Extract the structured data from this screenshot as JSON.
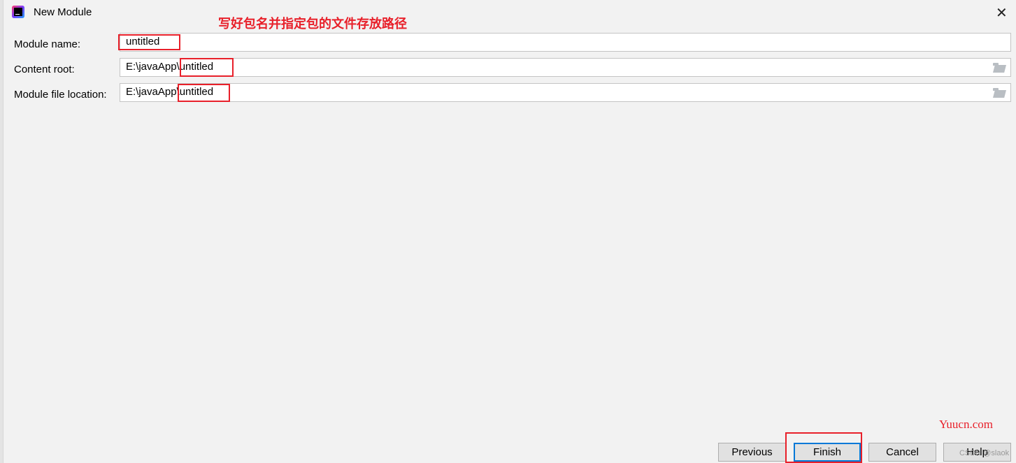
{
  "window": {
    "title": "New Module",
    "icon": "intellij-idea-icon",
    "close_icon": "close-icon"
  },
  "annotation": "写好包名并指定包的文件存放路径",
  "form": {
    "module_name": {
      "label": "Module name:",
      "value": "untitled"
    },
    "content_root": {
      "label": "Content root:",
      "value": "E:\\javaApp\\untitled"
    },
    "module_file_location": {
      "label": "Module file location:",
      "value": "E:\\javaApp\\untitled"
    }
  },
  "buttons": {
    "previous": "Previous",
    "finish": "Finish",
    "cancel": "Cancel",
    "help": "Help"
  },
  "watermarks": {
    "site": "Yuucn.com",
    "csdn": "CSDN @slaok"
  },
  "colors": {
    "annotation_red": "#e8202a",
    "focus_blue": "#0078d7"
  }
}
